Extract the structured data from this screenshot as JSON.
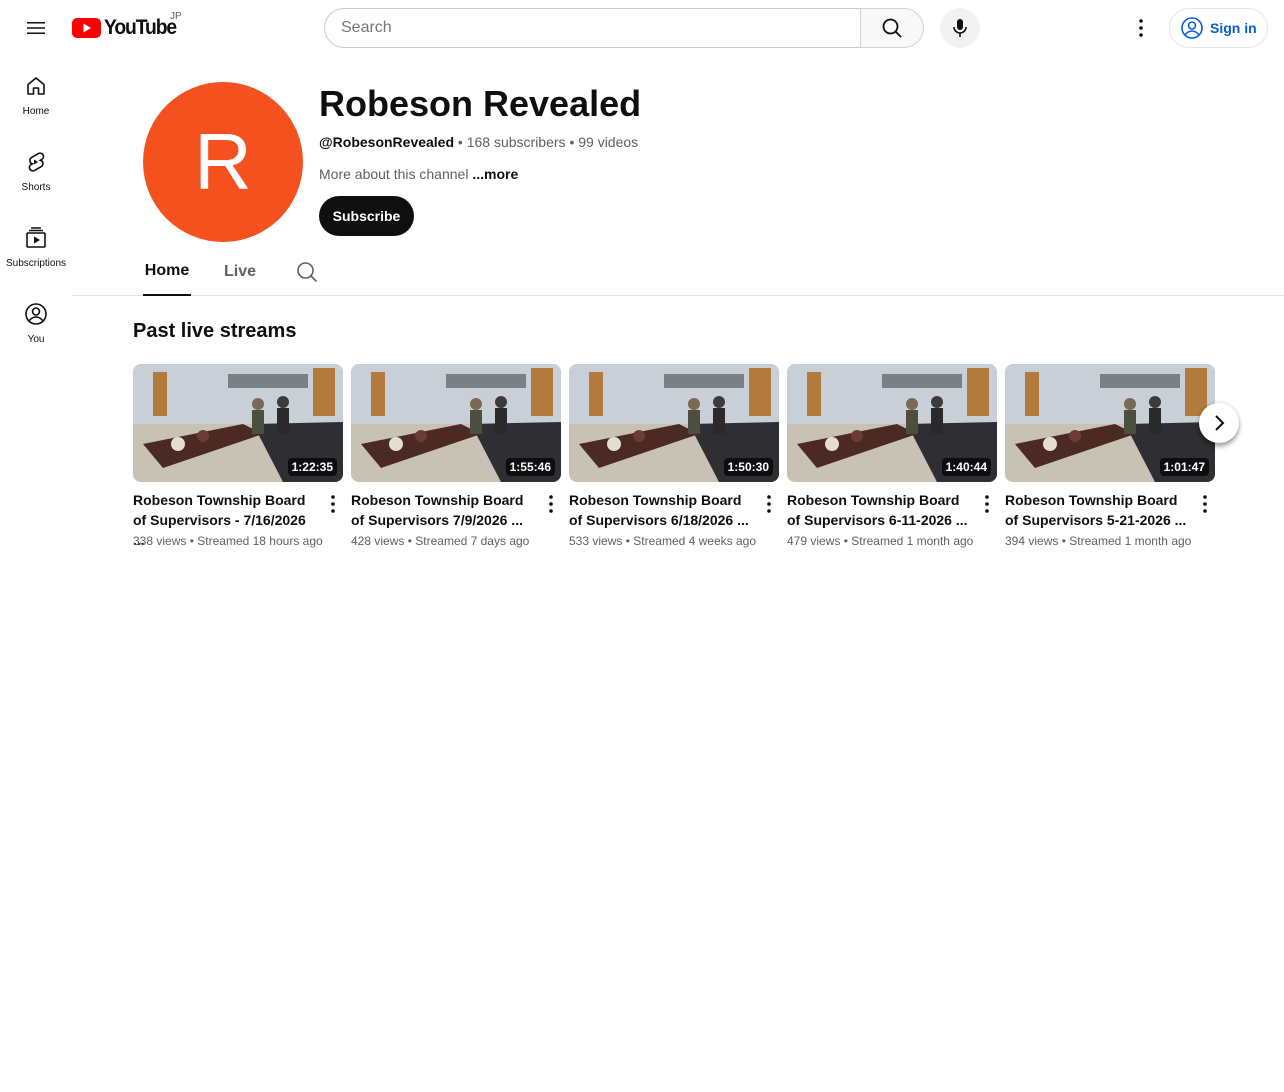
{
  "masthead": {
    "logo_text": "YouTube",
    "country_code": "JP",
    "search_placeholder": "Search",
    "signin_label": "Sign in",
    "icons": [
      "menu-icon",
      "youtube-logo-icon",
      "search-icon",
      "microphone-icon",
      "more-vert-icon",
      "account-circle-icon"
    ]
  },
  "guide": {
    "items": [
      {
        "label": "Home",
        "icon": "home-icon"
      },
      {
        "label": "Shorts",
        "icon": "shorts-icon"
      },
      {
        "label": "Subscriptions",
        "icon": "subscriptions-icon"
      },
      {
        "label": "You",
        "icon": "account-icon"
      }
    ]
  },
  "channel": {
    "avatar_letter": "R",
    "avatar_color": "#f4511e",
    "title": "Robeson Revealed",
    "handle": "@RobesonRevealed",
    "subscribers": "168 subscribers",
    "videos": "99 videos",
    "separator": "•",
    "about_text": "More about this channel",
    "about_more": "...more",
    "subscribe_label": "Subscribe"
  },
  "tabs": {
    "items": [
      "Home",
      "Live"
    ],
    "active": "Home"
  },
  "shelf": {
    "title": "Past live streams",
    "videos": [
      {
        "title": "Robeson Township Board of Supervisors - 7/16/2026 ...",
        "duration": "1:22:35",
        "views": "338 views",
        "age": "Streamed 18 hours ago"
      },
      {
        "title": "Robeson Township Board of Supervisors 7/9/2026 ...",
        "duration": "1:55:46",
        "views": "428 views",
        "age": "Streamed 7 days ago"
      },
      {
        "title": "Robeson Township Board of Supervisors 6/18/2026 ...",
        "duration": "1:50:30",
        "views": "533 views",
        "age": "Streamed 4 weeks ago"
      },
      {
        "title": "Robeson Township Board of Supervisors 6-11-2026 ...",
        "duration": "1:40:44",
        "views": "479 views",
        "age": "Streamed 1 month ago"
      },
      {
        "title": "Robeson Township Board of Supervisors 5-21-2026 ...",
        "duration": "1:01:47",
        "views": "394 views",
        "age": "Streamed 1 month ago"
      }
    ]
  },
  "colors": {
    "brand_red": "#ff0000",
    "link_blue": "#065fd4",
    "text_primary": "#0f0f0f",
    "text_secondary": "#606060"
  }
}
